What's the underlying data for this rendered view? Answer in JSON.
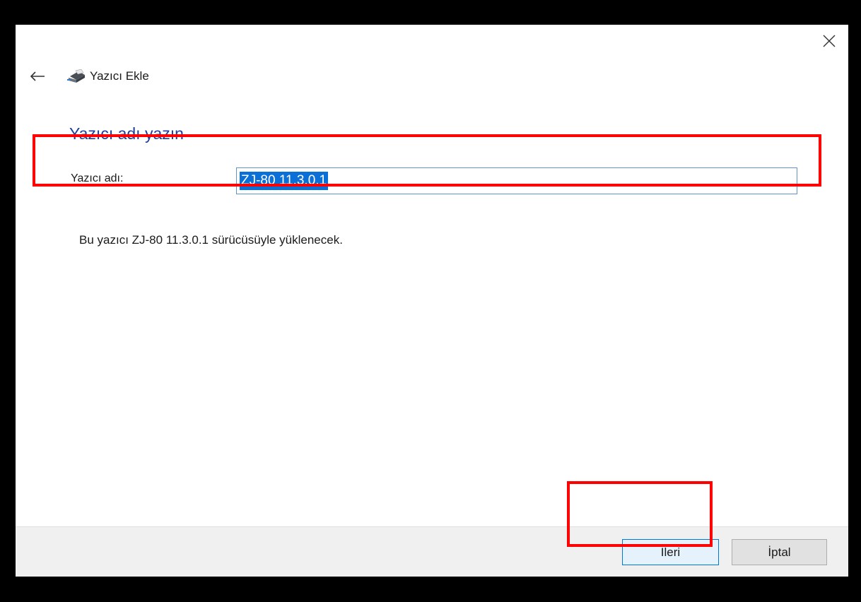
{
  "window": {
    "title": "Yazıcı Ekle",
    "close_icon": "close-icon",
    "back_icon": "back-arrow-icon",
    "app_icon": "printer-icon"
  },
  "page": {
    "heading": "Yazıcı adı yazın",
    "heading_color": "#1e3f9a"
  },
  "form": {
    "printer_name_label": "Yazıcı adı:",
    "printer_name_value": "ZJ-80 11.3.0.1",
    "value_selected": true
  },
  "info": {
    "driver_message": "Bu yazıcı ZJ-80 11.3.0.1 sürücüsüyle yüklenecek."
  },
  "footer": {
    "next_label": "İleri",
    "cancel_label": "İptal"
  },
  "annotations": {
    "highlight_color": "#ff0000"
  }
}
